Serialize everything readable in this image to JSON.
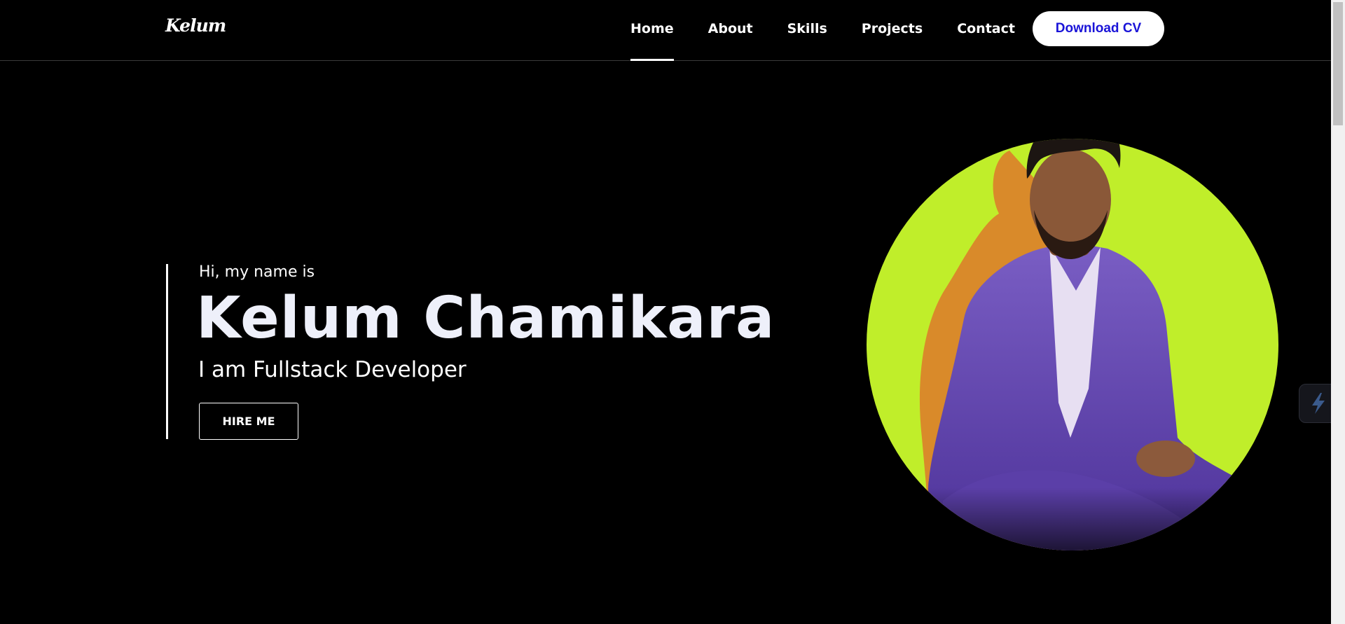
{
  "header": {
    "logo_text": "Kelum",
    "nav": [
      {
        "label": "Home",
        "active": true
      },
      {
        "label": "About",
        "active": false
      },
      {
        "label": "Skills",
        "active": false
      },
      {
        "label": "Projects",
        "active": false
      },
      {
        "label": "Contact",
        "active": false
      }
    ],
    "cv_button_label": "Download CV"
  },
  "hero": {
    "greeting": "Hi, my name is",
    "name": "Kelum Chamikara",
    "role": "I am Fullstack Developer",
    "hire_button_label": "HIRE ME"
  },
  "portrait": {
    "icon": "profile-photo",
    "circle_color": "#c0ee2a",
    "shadow_color": "#d98a2a",
    "suit_color": "#6b4fb0"
  },
  "widget": {
    "icon": "lightning-icon"
  },
  "colors": {
    "background": "#000000",
    "text": "#ffffff",
    "name_text": "#eef0fa",
    "cv_text": "#1a14d8"
  }
}
